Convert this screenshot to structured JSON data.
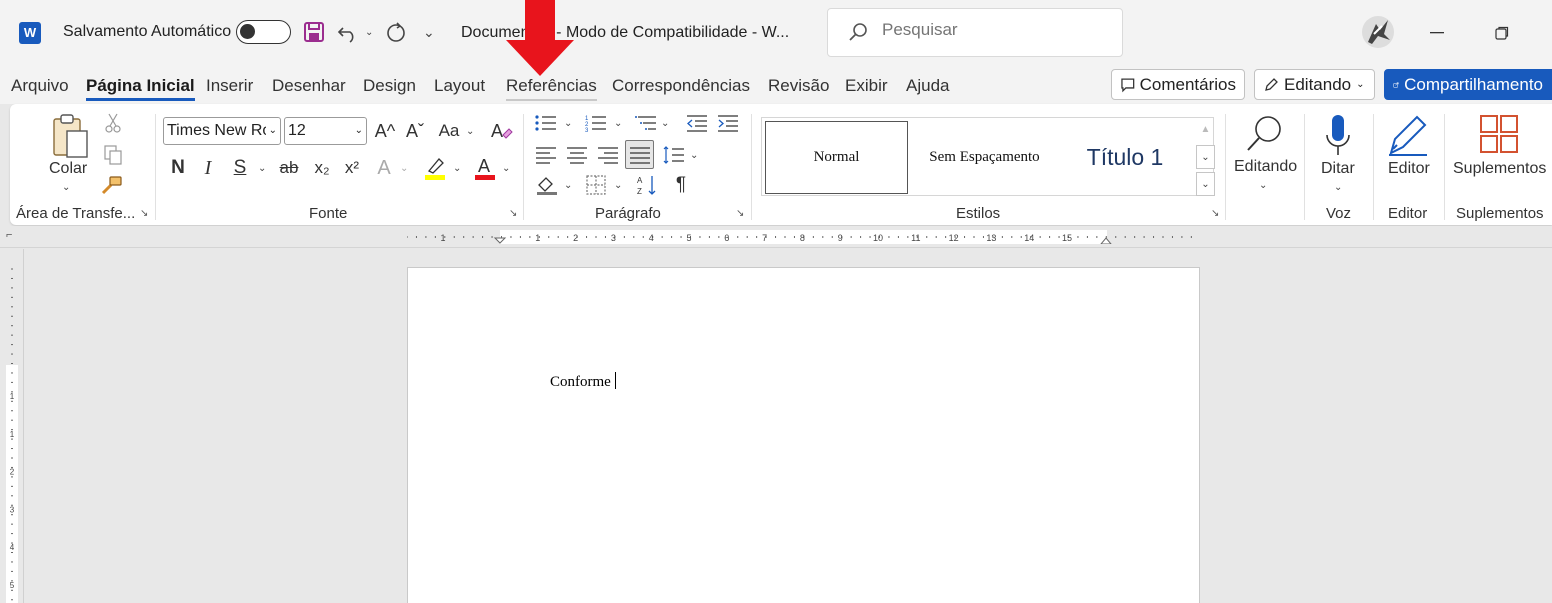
{
  "titlebar": {
    "app_logo": "W",
    "autosave_label": "Salvamento Automático",
    "document_title": "Documento1  -  Modo de Compatibilidade  -  W...",
    "search_placeholder": "Pesquisar"
  },
  "tabs": [
    {
      "label": "Arquivo"
    },
    {
      "label": "Página Inicial"
    },
    {
      "label": "Inserir"
    },
    {
      "label": "Desenhar"
    },
    {
      "label": "Design"
    },
    {
      "label": "Layout"
    },
    {
      "label": "Referências"
    },
    {
      "label": "Correspondências"
    },
    {
      "label": "Revisão"
    },
    {
      "label": "Exibir"
    },
    {
      "label": "Ajuda"
    }
  ],
  "actions": {
    "comments": "Comentários",
    "editing": "Editando",
    "share": "Compartilhamento"
  },
  "ribbon": {
    "clipboard": {
      "paste": "Colar",
      "group": "Área de Transfe..."
    },
    "font": {
      "group": "Fonte",
      "family": "Times New Ro",
      "size": "12",
      "grow": "A^",
      "shrink": "Aˇ",
      "case": "Aa",
      "bold": "N",
      "italic": "I",
      "underline": "S",
      "strike": "ab",
      "subscript": "x₂",
      "superscript": "x²",
      "font_color_letter": "A"
    },
    "paragraph": {
      "group": "Parágrafo"
    },
    "styles": {
      "group": "Estilos",
      "items": [
        "Normal",
        "Sem Espaçamento",
        "Título 1"
      ]
    },
    "editing": {
      "label": "Editando"
    },
    "voice": {
      "label": "Ditar",
      "group": "Voz"
    },
    "editor": {
      "label": "Editor",
      "group": "Editor"
    },
    "addins": {
      "label": "Suplementos",
      "group": "Suplementos"
    }
  },
  "ruler": {
    "labels": [
      "1",
      "1",
      "2",
      "3",
      "4",
      "5",
      "6",
      "7",
      "8",
      "9",
      "10",
      "11",
      "12",
      "13",
      "14",
      "15"
    ],
    "vertical_labels": [
      "1",
      "1",
      "2",
      "3",
      "4",
      "5"
    ]
  },
  "document": {
    "text": "Conforme"
  },
  "colors": {
    "accent": "#185abd",
    "arrow": "#e8141c",
    "highlight": "#ffff00",
    "font_color": "#e8141c"
  }
}
